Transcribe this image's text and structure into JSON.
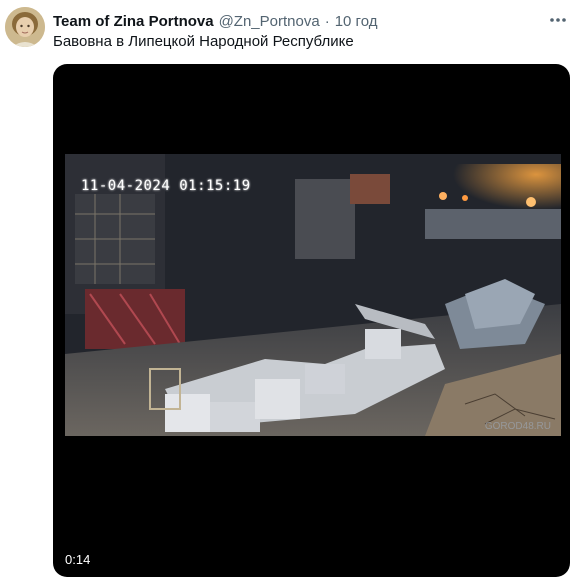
{
  "tweet": {
    "author_name": "Team of Zina Portnova",
    "handle": "@Zn_Portnova",
    "separator": "·",
    "time": "10 год",
    "text": "Бавовна в Липецкой Народной Республике"
  },
  "media": {
    "video_timestamp": "11-04-2024 01:15:19",
    "watermark": "GOROD48.RU",
    "duration": "0:14"
  },
  "icons": {
    "more": "more-horizontal-icon"
  }
}
